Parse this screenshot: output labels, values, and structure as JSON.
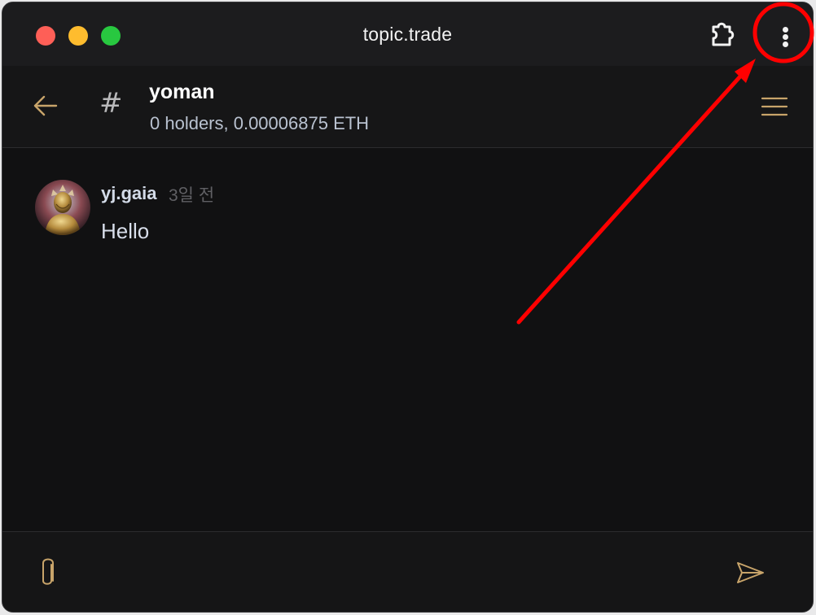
{
  "window": {
    "title": "topic.trade",
    "icons": {
      "extension": "puzzle-extension-icon",
      "more": "kebab-menu-icon"
    },
    "colors": {
      "close": "#fe5f57",
      "minimize": "#febc2e",
      "maximize": "#28c840"
    }
  },
  "header": {
    "channel_name": "yoman",
    "subtitle": "0 holders, 0.00006875 ETH",
    "hash_symbol": "#",
    "icons": {
      "back": "arrow-left-icon",
      "menu": "hamburger-menu-icon"
    },
    "accent_color": "#c8a46a"
  },
  "messages": [
    {
      "author": "yj.gaia",
      "time": "3일 전",
      "text": "Hello",
      "avatar_icon": "avatar-statue"
    }
  ],
  "composer": {
    "icons": {
      "attach": "paperclip-icon",
      "send": "send-icon"
    }
  },
  "annotation": {
    "shape": "red circle and arrow highlighting the more-options button",
    "color": "#ff0000"
  }
}
